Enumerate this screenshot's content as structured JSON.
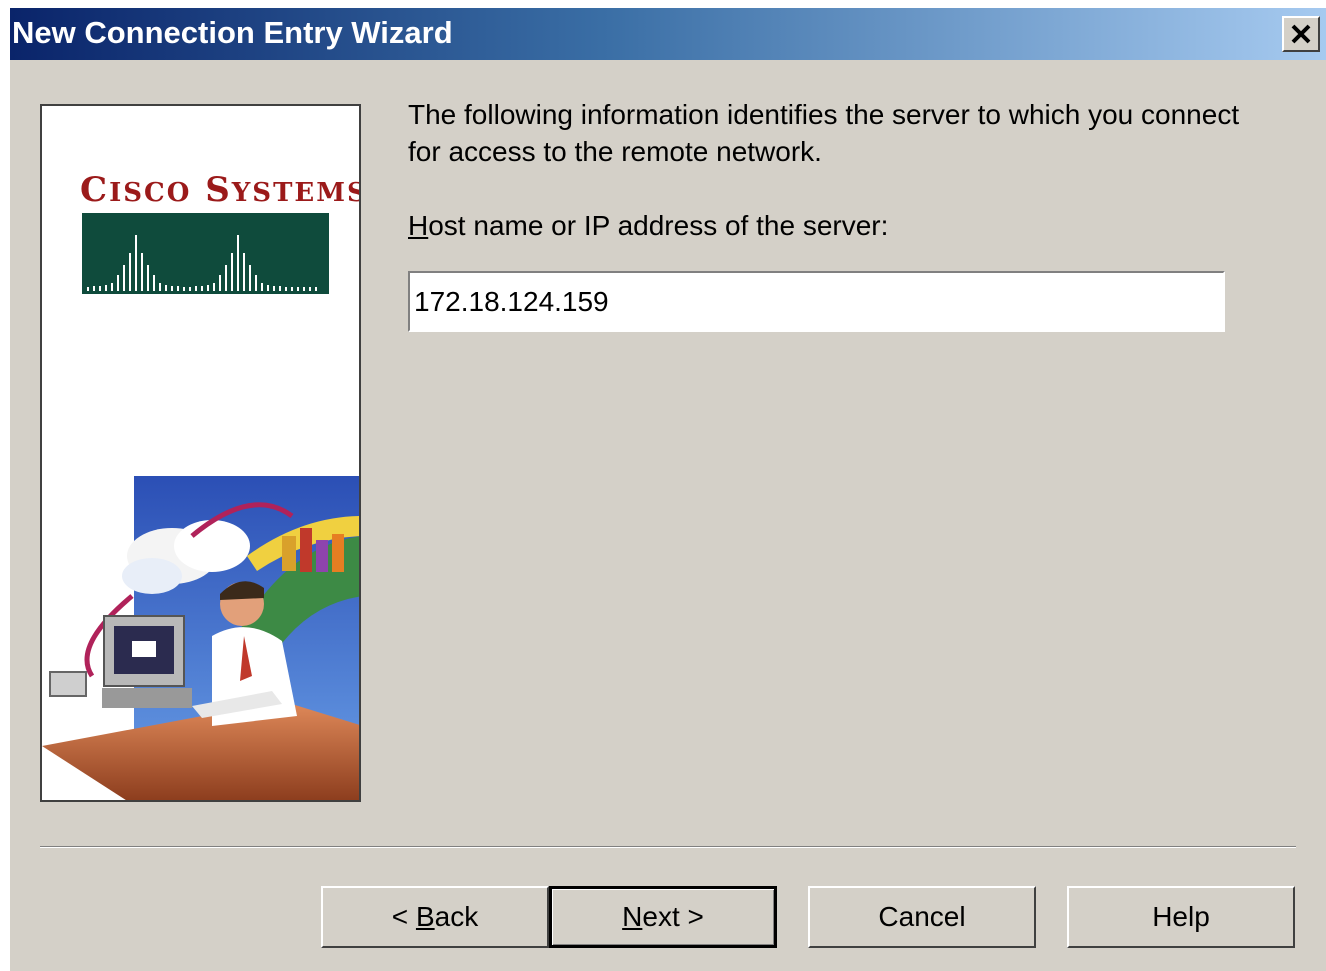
{
  "window": {
    "title": "New Connection Entry Wizard"
  },
  "logo": {
    "name_first_initial": "C",
    "name_first_rest": "ISCO",
    "name_second_initial": "S",
    "name_second_rest": "YSTEMS"
  },
  "main": {
    "description": "The following information identifies the server to which you connect for access to the remote network.",
    "field_label_access": "H",
    "field_label_rest": "ost name or IP address of the server:",
    "host_value": "172.18.124.159"
  },
  "buttons": {
    "back_prefix": "< ",
    "back_access": "B",
    "back_rest": "ack",
    "next_access": "N",
    "next_rest": "ext >",
    "cancel": "Cancel",
    "help": "Help"
  },
  "icons": {
    "close": "close-icon",
    "logo_bars": "cisco-bridge-bars-icon",
    "illustration": "remote-user-illustration"
  },
  "colors": {
    "title_gradient_start": "#0a246a",
    "title_gradient_end": "#a6caf0",
    "dialog_face": "#d4d0c8",
    "logo_red": "#9b1a1a",
    "logo_green": "#0f4b3c"
  }
}
